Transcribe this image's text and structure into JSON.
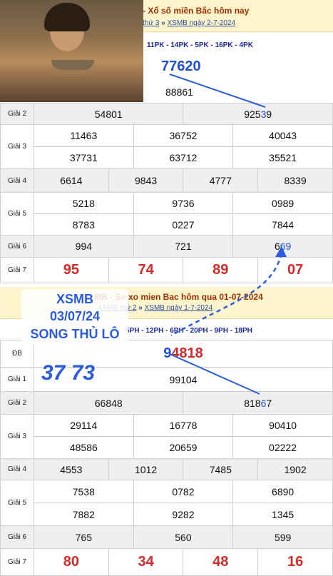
{
  "top": {
    "title": "- Xổ số miền Bắc hôm nay",
    "crumb_left": "thứ 3",
    "crumb_sep": "»",
    "crumb_right": "XSMB ngày 2-7-2024",
    "codes": "11PK - 14PK - 5PK - 16PK - 4PK",
    "db": "77620",
    "g1": "88861",
    "labels": {
      "g2": "Giải 2",
      "g3": "Giải 3",
      "g4": "Giải 4",
      "g5": "Giải 5",
      "g6": "Giải 6",
      "g7": "Giải 7"
    },
    "g2": [
      "54801",
      "92539"
    ],
    "g3": [
      "11463",
      "36752",
      "40043",
      "37731",
      "63712",
      "35521"
    ],
    "g4": [
      "6614",
      "9843",
      "4777",
      "8339"
    ],
    "g5": [
      "5218",
      "9736",
      "0989",
      "8783",
      "0227",
      "7844"
    ],
    "g6": [
      "994",
      "721",
      "669"
    ],
    "g7": [
      "95",
      "74",
      "89",
      "07"
    ]
  },
  "bottom": {
    "title": "MB - So xo mien Bac hôm qua 01-07-2024",
    "crumb_left": "XSMB thứ 2",
    "crumb_sep": "»",
    "crumb_right": "XSMB ngày 1-7-2024",
    "codes": "5PH - 12PH - 6PH - 20PH - 9PH - 18PH",
    "labels": {
      "db": "ĐB",
      "g1": "Giải 1",
      "g2": "Giải 2",
      "g3": "Giải 3",
      "g4": "Giải 4",
      "g5": "Giải 5",
      "g6": "Giải 6",
      "g7": "Giải 7"
    },
    "db": "94818",
    "g1": "99104",
    "g2": [
      "66848",
      "81867"
    ],
    "g3": [
      "29114",
      "16778",
      "90410",
      "48586",
      "20659",
      "02222"
    ],
    "g4": [
      "4553",
      "1012",
      "7485",
      "1902"
    ],
    "g5": [
      "7538",
      "0782",
      "6890",
      "7882",
      "9282",
      "1345"
    ],
    "g6": [
      "765",
      "560",
      "599"
    ],
    "g7": [
      "80",
      "34",
      "48",
      "16"
    ]
  },
  "overlay": {
    "line1": "XSMB",
    "line2": "03/07/24",
    "line3": "SONG THỦ LÔ",
    "pair": "37 73"
  },
  "colors": {
    "accent": "#1e4fd0",
    "special": "#d42a2a",
    "banner": "#fff5cc"
  }
}
